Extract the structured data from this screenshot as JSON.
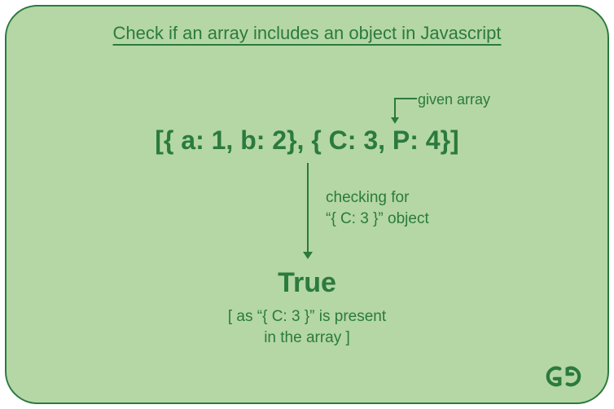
{
  "title": "Check if an array includes an object in Javascript",
  "given_array_label": "given array",
  "array_expression": "[{ a: 1, b: 2}, { C: 3, P: 4}]",
  "check_label_line1": "checking for",
  "check_label_line2": "“{ C: 3 }” object",
  "result": "True",
  "explain_line1": "[ as “{ C: 3 }” is present",
  "explain_line2": "in the array ]",
  "colors": {
    "bg": "#b4d7a5",
    "fg": "#2b7a3e"
  }
}
